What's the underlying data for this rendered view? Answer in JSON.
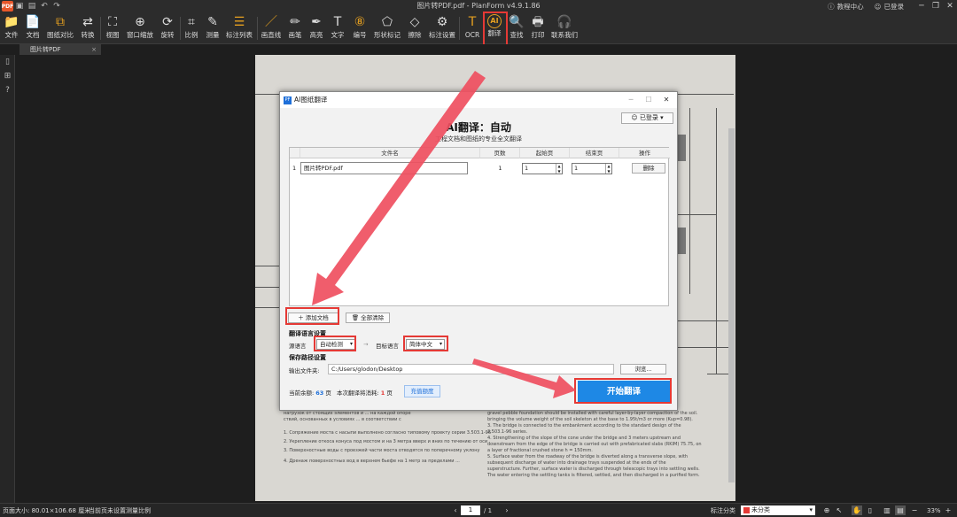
{
  "titlebar": {
    "app_logo": "PDF",
    "title": "图片转PDF.pdf - PlanForm v4.9.1.86",
    "help_center": "教程中心",
    "logged_in": "已登录",
    "qa_icons": [
      "save-icon",
      "undo-icon",
      "redo-icon",
      "open-icon"
    ]
  },
  "toolbar": {
    "items": [
      {
        "id": "file",
        "label": "文件",
        "icon": "📁"
      },
      {
        "id": "doc",
        "label": "文档",
        "icon": "📄"
      },
      {
        "id": "compare",
        "label": "图纸对比",
        "icon": "⧉"
      },
      {
        "id": "convert",
        "label": "转换",
        "icon": "⇄"
      },
      {
        "id": "view",
        "label": "视图",
        "icon": "⛶"
      },
      {
        "id": "window-zoom",
        "label": "窗口缩放",
        "icon": "⊕"
      },
      {
        "id": "rotate",
        "label": "旋转",
        "icon": "⟳"
      },
      {
        "id": "scale",
        "label": "比例",
        "icon": "⌗"
      },
      {
        "id": "measure",
        "label": "测量",
        "icon": "✎"
      },
      {
        "id": "mark-list",
        "label": "标注列表",
        "icon": "☰"
      },
      {
        "id": "line",
        "label": "画直线",
        "icon": "／"
      },
      {
        "id": "brush",
        "label": "画笔",
        "icon": "✏"
      },
      {
        "id": "highlight",
        "label": "高亮",
        "icon": "✒"
      },
      {
        "id": "text",
        "label": "文字",
        "icon": "T"
      },
      {
        "id": "numbering",
        "label": "编号",
        "icon": "⑧"
      },
      {
        "id": "shape-mark",
        "label": "形状标记",
        "icon": "⬠"
      },
      {
        "id": "erase",
        "label": "擦除",
        "icon": "◇"
      },
      {
        "id": "mark-settings",
        "label": "标注设置",
        "icon": "⚙"
      },
      {
        "id": "ocr",
        "label": "OCR",
        "icon": "T"
      },
      {
        "id": "translate",
        "label": "翻译",
        "icon": "AI"
      },
      {
        "id": "find",
        "label": "查找",
        "icon": "🔍"
      },
      {
        "id": "print",
        "label": "打印",
        "icon": "🖶"
      },
      {
        "id": "contact",
        "label": "联系我们",
        "icon": "🎧"
      }
    ]
  },
  "tab": {
    "name": "图片转PDF",
    "close": "×"
  },
  "sidebar_icons": [
    "bookmark-icon",
    "grid-icon",
    "help-icon"
  ],
  "statusbar": {
    "page_size": "页面大小: 80.01×106.68 厘米",
    "scale_info": "当前页未设置测量比例",
    "page_current": "1",
    "page_total": "/ 1",
    "mark_category_label": "标注分类",
    "category": "未分类",
    "zoom": "33%"
  },
  "dialog": {
    "title": "AI图纸翻译",
    "logo": "PF",
    "login": "已登录",
    "heading": "AI翻译：自动",
    "subheading": "工程文档和图纸的专业全文翻译",
    "columns": [
      "文件名",
      "页数",
      "起始页",
      "结束页",
      "操作"
    ],
    "rows": [
      {
        "index": "1",
        "file": "图片转PDF.pdf",
        "pages": "1",
        "start": "1",
        "end": "1",
        "action": "删除"
      }
    ],
    "add_doc": "添加文档",
    "clear_all": "全部清除",
    "lang_section": "翻译语言设置",
    "source_label": "源语言",
    "source_value": "自动检测",
    "arrow": "→",
    "target_label": "目标语言",
    "target_value": "简体中文",
    "save_section": "保存路径设置",
    "output_label": "输出文件夹:",
    "output_path": "C:/Users/glodon/Desktop",
    "browse": "浏览...",
    "balance_label": "当前余额:",
    "balance_value": "63",
    "balance_unit": "页",
    "cost_label": "本次翻译将消耗:",
    "cost_value": "1",
    "cost_unit": "页",
    "recharge": "充值额度",
    "start": "开始翻译"
  },
  "page_texts": [
    "нагрузок от стоящих элементов и ... на каждой опоре",
    "ствий, основанных в условиях ... в соответствии с",
    "1. Сопряжение моста с насыпи выполнено согласно типовому проекту серии 3.503.1-96",
    "2. Укрепление откоса конуса под мостом и на 3 метра вверх и вниз по течению от оси",
    "3. Поверхностные воды с проезжей части моста отводятся по поперечному уклону",
    "4. Дренаж поверхностных вод в верхнем бьефе на 1 метр за пределами ...",
    "gravel pebble foundation should be installed with careful layer-by-layer compaction of the soil.",
    "bringing the volume weight of the soil skeleton at the base to 1.95t/m3 or more (Kup=0.98).",
    "3.      The bridge is connected to the embankment according to the standard design of the",
    "3.503.1-96 series.",
    "4.      Strengthening of the slope of the cone under the bridge and 3 meters upstream and",
    "downstream from the edge of the bridge is carried out with prefabricated slabs (RKIM) 75.75, on",
    "a layer of fractional crushed stone h = 150mm.",
    "5.      Surface water from the roadway of the bridge is diverted along a transverse slope, with",
    "subsequent discharge of water into drainage trays suspended at the ends of the",
    "superstructure. Further, surface water is discharged through telescopic trays into settling wells.",
    "The water entering the settling tanks is filtered, settled, and then discharged in a purified form."
  ]
}
